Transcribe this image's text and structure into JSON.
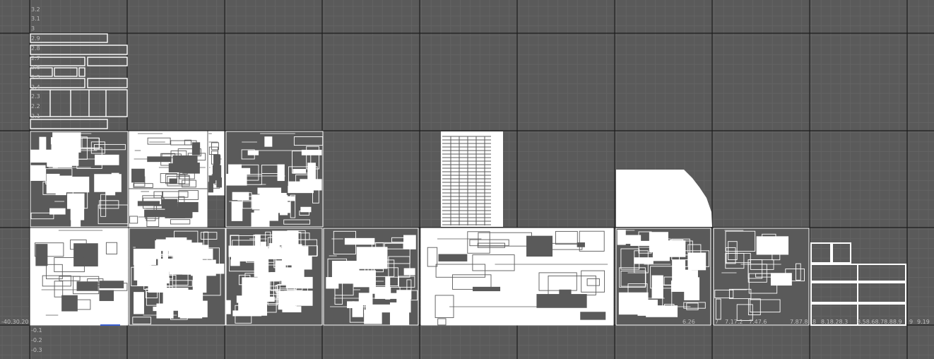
{
  "editor": {
    "name": "UV Texture Editor",
    "colors": {
      "background": "#5a5a5a",
      "grid_minor": "#636363",
      "grid_major": "#1e1e1e",
      "uv_shell": "#ffffff",
      "uv_fill": "#5a5a5a",
      "axis_label": "#bdbdbd",
      "selection_edge": "#3a5fd0"
    }
  },
  "axis_labels": {
    "v_top": [
      "3.2",
      "3.1",
      "3",
      "2.9",
      "2.8",
      "2.7",
      "2.6",
      "2.5",
      "2.4",
      "2.3",
      "2.2",
      "2.1"
    ],
    "v_bottom": [
      "-0.1",
      "-0.2",
      "-0.3"
    ],
    "u_left": "-40.30.20",
    "u_right": [
      "6.26",
      "7",
      "7.17.2",
      "7.47.6",
      "7.87.8",
      "8",
      "8.18.28.3",
      "8.58.68.78.88.9",
      "9",
      "9.19"
    ]
  }
}
